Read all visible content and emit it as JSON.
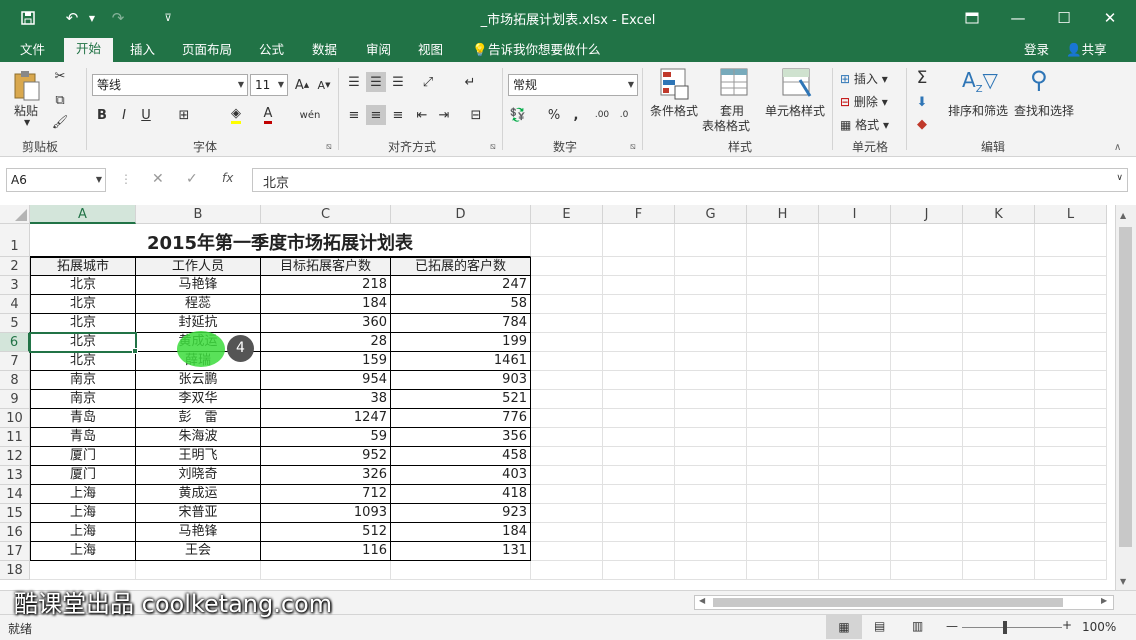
{
  "window": {
    "title": "_市场拓展计划表.xlsx - Excel",
    "colors": {
      "brand": "#217346",
      "select": "#d3e5da"
    }
  },
  "tabs": [
    "文件",
    "开始",
    "插入",
    "页面布局",
    "公式",
    "数据",
    "审阅",
    "视图"
  ],
  "tell_me": "告诉我你想要做什么",
  "account": {
    "login": "登录",
    "share": "共享"
  },
  "ribbon": {
    "clipboard": {
      "label": "剪贴板",
      "paste": "粘贴"
    },
    "font": {
      "label": "字体",
      "name": "等线",
      "size": "11",
      "bold": "B",
      "italic": "I",
      "underline": "U"
    },
    "alignment": {
      "label": "对齐方式"
    },
    "number": {
      "label": "数字",
      "format": "常规",
      "percent": "%",
      "comma": ","
    },
    "styles": {
      "label": "样式",
      "conditional": "条件格式",
      "table_format_1": "套用",
      "table_format_2": "表格格式",
      "cell_styles": "单元格样式"
    },
    "cells": {
      "label": "单元格",
      "insert": "插入",
      "delete": "删除",
      "format": "格式"
    },
    "editing": {
      "label": "编辑",
      "sort_filter": "排序和筛选",
      "find_select": "查找和选择"
    }
  },
  "formula_bar": {
    "name_box": "A6",
    "fx": "fx",
    "value": "北京"
  },
  "columns": [
    "A",
    "B",
    "C",
    "D",
    "E",
    "F",
    "G",
    "H",
    "I",
    "J",
    "K",
    "L"
  ],
  "sheet": {
    "title": "2015年第一季度市场拓展计划表",
    "headers": [
      "拓展城市",
      "工作人员",
      "目标拓展客户数",
      "已拓展的客户数"
    ],
    "rows": [
      [
        "北京",
        "马艳锋",
        "218",
        "247"
      ],
      [
        "北京",
        "程蕊",
        "184",
        "58"
      ],
      [
        "北京",
        "封延抗",
        "360",
        "784"
      ],
      [
        "北京",
        "黄成运",
        "28",
        "199"
      ],
      [
        "北京",
        "薛瑞",
        "159",
        "1461"
      ],
      [
        "南京",
        "张云鹏",
        "954",
        "903"
      ],
      [
        "南京",
        "李双华",
        "38",
        "521"
      ],
      [
        "青岛",
        "彭　雷",
        "1247",
        "776"
      ],
      [
        "青岛",
        "朱海波",
        "59",
        "356"
      ],
      [
        "厦门",
        "王明飞",
        "952",
        "458"
      ],
      [
        "厦门",
        "刘晓奇",
        "326",
        "403"
      ],
      [
        "上海",
        "黄成运",
        "712",
        "418"
      ],
      [
        "上海",
        "宋普亚",
        "1093",
        "923"
      ],
      [
        "上海",
        "马艳锋",
        "512",
        "184"
      ],
      [
        "上海",
        "王会",
        "116",
        "131"
      ]
    ]
  },
  "row_numbers": [
    "1",
    "2",
    "3",
    "4",
    "5",
    "6",
    "7",
    "8",
    "9",
    "10",
    "11",
    "12",
    "13",
    "14",
    "15",
    "16",
    "17",
    "18"
  ],
  "step_badge": "4",
  "status": {
    "ready": "就绪",
    "zoom": "100%"
  },
  "watermark": "酷课堂出品 coolketang.com"
}
